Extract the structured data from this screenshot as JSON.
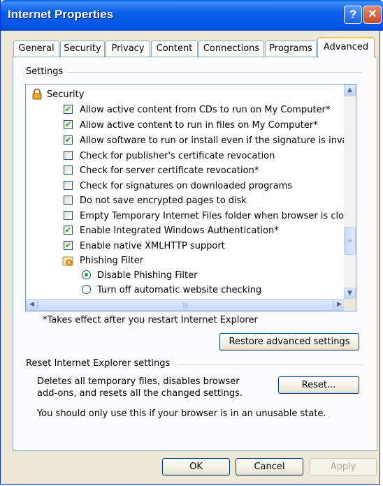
{
  "window": {
    "title": "Internet Properties",
    "help_label": "?",
    "close_label": "✕"
  },
  "tabs": [
    {
      "label": "General"
    },
    {
      "label": "Security"
    },
    {
      "label": "Privacy"
    },
    {
      "label": "Content"
    },
    {
      "label": "Connections"
    },
    {
      "label": "Programs"
    },
    {
      "label": "Advanced",
      "active": true
    }
  ],
  "settings": {
    "group_label": "Settings",
    "category": "Security",
    "items": [
      {
        "label": "Allow active content from CDs to run on My Computer*",
        "checked": true
      },
      {
        "label": "Allow active content to run in files on My Computer*",
        "checked": true
      },
      {
        "label": "Allow software to run or install even if the signature is inva",
        "checked": true
      },
      {
        "label": "Check for publisher's certificate revocation",
        "checked": false
      },
      {
        "label": "Check for server certificate revocation*",
        "checked": false
      },
      {
        "label": "Check for signatures on downloaded programs",
        "checked": false
      },
      {
        "label": "Do not save encrypted pages to disk",
        "checked": false
      },
      {
        "label": "Empty Temporary Internet Files folder when browser is clo",
        "checked": false
      },
      {
        "label": "Enable Integrated Windows Authentication*",
        "checked": true
      },
      {
        "label": "Enable native XMLHTTP support",
        "checked": true
      }
    ],
    "sub_category": "Phishing Filter",
    "radio_options": [
      {
        "label": "Disable Phishing Filter",
        "selected": true
      },
      {
        "label": "Turn off automatic website checking",
        "selected": false
      }
    ],
    "note": "*Takes effect after you restart Internet Explorer",
    "restore_button": "Restore advanced settings"
  },
  "reset": {
    "group_label": "Reset Internet Explorer settings",
    "description_line1": "Deletes all temporary files, disables browser",
    "description_line2": "add-ons, and resets all the changed settings.",
    "reset_button": "Reset...",
    "warning": "You should only use this if your browser is in an unusable state."
  },
  "footer": {
    "ok": "OK",
    "cancel": "Cancel",
    "apply": "Apply"
  },
  "colors": {
    "titlebar": "#0a5ee6",
    "check_mark": "#21a121",
    "active_tab_accent": "#ffc83c"
  }
}
